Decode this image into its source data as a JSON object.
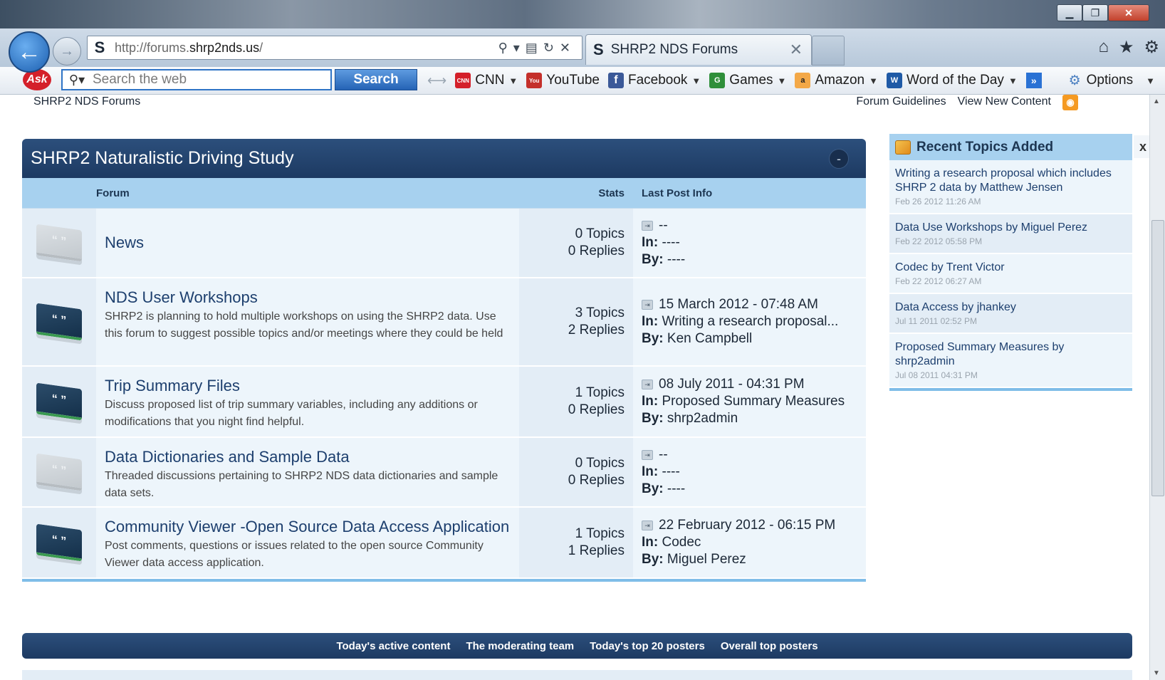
{
  "browser": {
    "url_prefix": "http://forums.",
    "url_domain": "shrp2nds.us",
    "url_suffix": "/",
    "tab_title": "SHRP2 NDS Forums",
    "favicon": "S"
  },
  "ask_toolbar": {
    "logo": "Ask",
    "search_placeholder": "Search the web",
    "search_button": "Search",
    "items": [
      {
        "label": "CNN",
        "icon": "cnn-icon",
        "color": "#d4202a",
        "glyph": "CNN"
      },
      {
        "label": "YouTube",
        "icon": "youtube-icon",
        "color": "#c4302b",
        "glyph": "You"
      },
      {
        "label": "Facebook",
        "icon": "facebook-icon",
        "color": "#3b5998",
        "glyph": "f"
      },
      {
        "label": "Games",
        "icon": "games-icon",
        "color": "#2f8f3a",
        "glyph": "G"
      },
      {
        "label": "Amazon",
        "icon": "amazon-icon",
        "color": "#f3a847",
        "glyph": "a"
      },
      {
        "label": "Word of the Day",
        "icon": "book-icon",
        "color": "#1f5aa6",
        "glyph": "W"
      }
    ],
    "more": "»",
    "options": "Options"
  },
  "page": {
    "crumb": "SHRP2 NDS Forums",
    "links": [
      "Forum Guidelines",
      "View New Content"
    ]
  },
  "category": {
    "title": "SHRP2 Naturalistic Driving Study",
    "collapse": "-",
    "col_forum": "Forum",
    "col_stats": "Stats",
    "col_last": "Last Post Info",
    "in_label": "In:",
    "by_label": "By:",
    "forums": [
      {
        "name": "News",
        "desc": "",
        "topics": "0 Topics",
        "replies": "0 Replies",
        "date": "--",
        "in": "----",
        "by": "----",
        "state": "light"
      },
      {
        "name": "NDS User Workshops",
        "desc": "SHRP2 is planning to hold multiple workshops on using the SHRP2 data. Use this forum to suggest possible topics and/or meetings where they could be held",
        "topics": "3 Topics",
        "replies": "2 Replies",
        "date": "15 March 2012 - 07:48 AM",
        "in": "Writing a research proposal...",
        "by": "Ken Campbell",
        "state": "dark"
      },
      {
        "name": "Trip Summary Files",
        "desc": "Discuss proposed list of trip summary variables, including any additions or modifications that you night find helpful.",
        "topics": "1 Topics",
        "replies": "0 Replies",
        "date": "08 July 2011 - 04:31 PM",
        "in": "Proposed Summary Measures",
        "by": "shrp2admin",
        "state": "dark"
      },
      {
        "name": "Data Dictionaries and Sample Data",
        "desc": "Threaded discussions pertaining to SHRP2 NDS data dictionaries and sample data sets.",
        "topics": "0 Topics",
        "replies": "0 Replies",
        "date": "--",
        "in": "----",
        "by": "----",
        "state": "light"
      },
      {
        "name": "Community Viewer -Open Source Data Access Application",
        "desc": "Post comments, questions or issues related to the open source Community Viewer data access application.",
        "topics": "1 Topics",
        "replies": "1 Replies",
        "date": "22 February 2012 - 06:15 PM",
        "in": "Codec",
        "by": "Miguel Perez",
        "state": "dark"
      }
    ]
  },
  "sidebar": {
    "title": "Recent Topics Added",
    "close": "x",
    "items": [
      {
        "title": "Writing a research proposal which includes SHRP 2 data by Matthew Jensen",
        "date": "Feb 26 2012 11:26 AM"
      },
      {
        "title": "Data Use Workshops by Miguel Perez",
        "date": "Feb 22 2012 05:58 PM"
      },
      {
        "title": "Codec by Trent Victor",
        "date": "Feb 22 2012 06:27 AM"
      },
      {
        "title": "Data Access by jhankey",
        "date": "Jul 11 2011 02:52 PM"
      },
      {
        "title": "Proposed Summary Measures by shrp2admin",
        "date": "Jul 08 2011 04:31 PM"
      }
    ]
  },
  "footer": {
    "links": [
      "Today's active content",
      "The moderating team",
      "Today's top 20 posters",
      "Overall top posters"
    ]
  }
}
